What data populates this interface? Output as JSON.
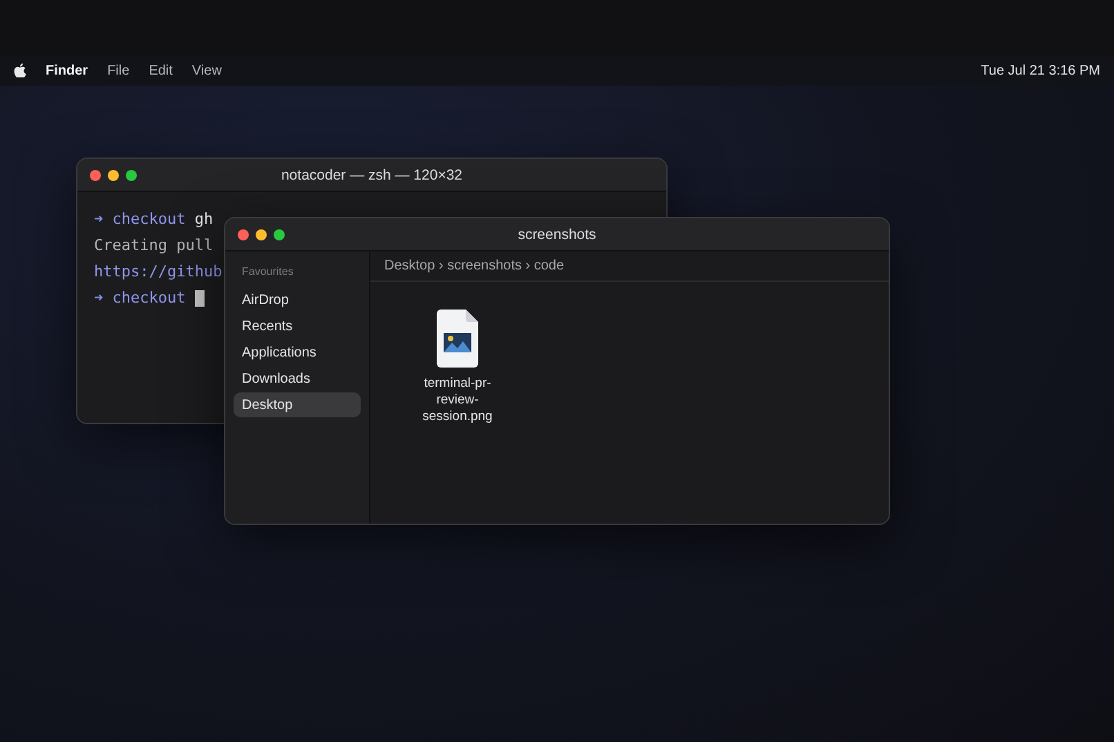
{
  "menubar": {
    "menus": [
      {
        "label": "Finder",
        "selected": true
      },
      {
        "label": "File",
        "selected": false
      },
      {
        "label": "Edit",
        "selected": false
      },
      {
        "label": "View",
        "selected": false
      }
    ],
    "clock": "Tue Jul 21 3:16 PM"
  },
  "terminal": {
    "title": "notacoder — zsh — 120×32",
    "lines": [
      {
        "kind": "prompt",
        "arrow": "➜",
        "dir": "checkout",
        "command": "gh",
        "cursor": false
      },
      {
        "kind": "output",
        "text": "Creating pull"
      },
      {
        "kind": "link",
        "text": "https://github"
      },
      {
        "kind": "prompt",
        "arrow": "➜",
        "dir": "checkout",
        "cursor": true
      }
    ]
  },
  "finder": {
    "title": "screenshots",
    "sidebar": {
      "heading": "Favourites",
      "items": [
        {
          "label": "AirDrop",
          "selected": false
        },
        {
          "label": "Recents",
          "selected": false
        },
        {
          "label": "Applications",
          "selected": false
        },
        {
          "label": "Downloads",
          "selected": false
        },
        {
          "label": "Desktop",
          "selected": true
        }
      ]
    },
    "path": [
      "Desktop",
      "screenshots",
      "code"
    ],
    "separator": "›",
    "files": [
      {
        "name": "terminal-pr-review-session.png",
        "kind": "image"
      }
    ]
  }
}
